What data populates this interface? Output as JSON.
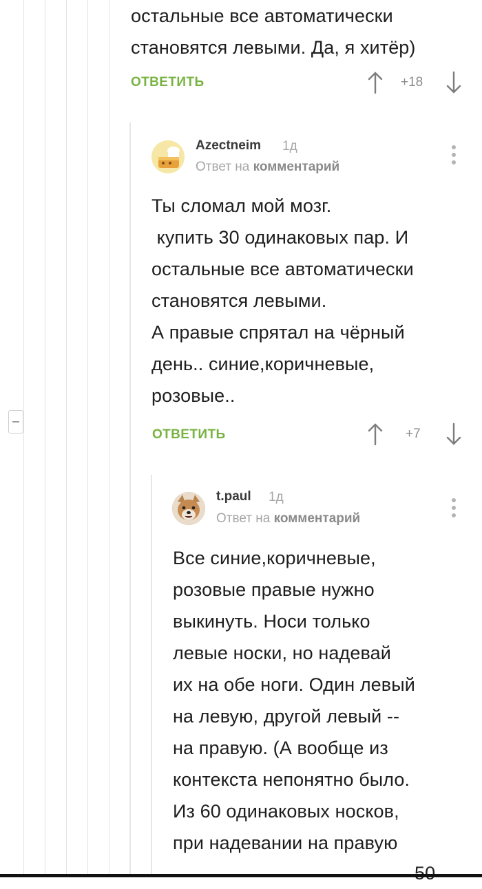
{
  "comment0": {
    "body_lines": [
      "остальные все автоматически",
      "становятся левыми. Да, я хитёр)"
    ],
    "reply_label": "ОТВЕТИТЬ",
    "score": "+18"
  },
  "comment1": {
    "author": "Azectneim",
    "time": "1д",
    "reply_to_prefix": "Ответ на",
    "reply_to_link": "комментарий",
    "body_lines": [
      "Ты сломал мой мозг.",
      " купить 30 одинаковых пар. И",
      "остальные все автоматически",
      "становятся левыми.",
      "А правые спрятал на чёрный",
      "день.. синие,коричневые,",
      "розовые.."
    ],
    "reply_label": "ОТВЕТИТЬ",
    "score": "+7"
  },
  "comment2": {
    "author": "t.paul",
    "time": "1д",
    "reply_to_prefix": "Ответ на",
    "reply_to_link": "комментарий",
    "body_lines": [
      "Все синие,коричневые,",
      "розовые правые нужно",
      "выкинуть. Носи только",
      "левые носки, но надевай",
      "их на обе ноги. Один левый",
      "на левую, другой левый --",
      "на правую. (А вообще из",
      "контекста непонятно было.",
      "Из 60 одинаковых носков,",
      "при надевании на правую"
    ],
    "partial_text": "50"
  },
  "icons": {
    "upvote": "arrow-up-icon",
    "downvote": "arrow-down-icon",
    "menu": "more-vertical-icon",
    "collapse": "collapse-minus-icon"
  },
  "colors": {
    "reply": "#78b341",
    "lines": "#e3e3e3"
  }
}
